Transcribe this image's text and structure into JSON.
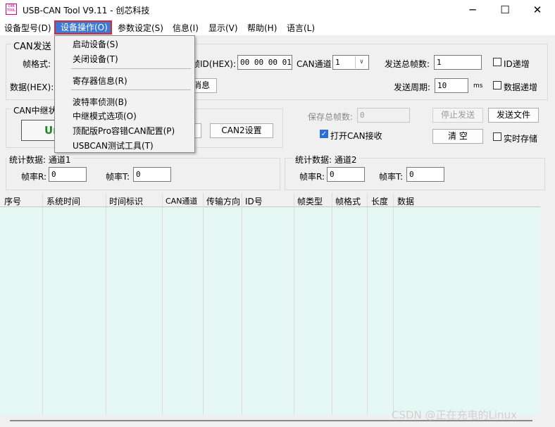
{
  "window": {
    "title": "USB-CAN Tool V9.11 - 创芯科技",
    "icon_text": [
      "CAN",
      "TOOL"
    ],
    "controls": {
      "minimize": "─",
      "maximize": "☐",
      "close": "✕"
    }
  },
  "menubar": {
    "items": [
      "设备型号(D)",
      "设备操作(O)",
      "参数设定(S)",
      "信息(I)",
      "显示(V)",
      "帮助(H)",
      "语言(L)"
    ],
    "active_index": 1
  },
  "dropdown": {
    "groups": [
      [
        "启动设备(S)",
        "关闭设备(T)"
      ],
      [
        "寄存器信息(R)"
      ],
      [
        "波特率侦测(B)",
        "中继模式选项(O)",
        "顶配版Pro容错CAN配置(P)",
        "USBCAN测试工具(T)"
      ]
    ]
  },
  "can_send": {
    "group_title": "CAN发送",
    "frame_format_label": "帧格式:",
    "data_label": "数据(HEX):",
    "frame_id_label": "帧ID(HEX):",
    "frame_id_value": "00 00 00 01",
    "channel_label": "CAN通道:",
    "channel_value": "1",
    "total_frames_label": "发送总帧数:",
    "total_frames_value": "1",
    "id_increment_label": "ID递增",
    "period_label": "发送周期:",
    "period_value": "10",
    "period_unit": "ms",
    "data_increment_label": "数据递增",
    "send_message_fragment": "消息"
  },
  "can_relay": {
    "group_title": "CAN中继状态",
    "status_fragment": "Ur",
    "can2_settings_label": "CAN2设置",
    "saved_frames_label": "保存总帧数:",
    "saved_frames_value": "0",
    "open_receive_label": "打开CAN接收",
    "stop_send_label": "停止发送",
    "send_file_label": "发送文件",
    "clear_label": "清 空",
    "realtime_save_label": "实时存储"
  },
  "stats": [
    {
      "title": "统计数据: 通道1",
      "rate_r_label": "帧率R:",
      "rate_r_value": "0",
      "rate_t_label": "帧率T:",
      "rate_t_value": "0"
    },
    {
      "title": "统计数据: 通道2",
      "rate_r_label": "帧率R:",
      "rate_r_value": "0",
      "rate_t_label": "帧率T:",
      "rate_t_value": "0"
    }
  ],
  "table": {
    "columns": [
      "序号",
      "系统时间",
      "时间标识",
      "CAN通道",
      "传输方向",
      "ID号",
      "帧类型",
      "帧格式",
      "长度",
      "数据"
    ]
  },
  "watermark": "CSDN @正在充电的Linux",
  "colors": {
    "accent": "#3b78d8",
    "highlight_border": "#e0282c",
    "grid_bg": "#e6f8f4",
    "status_green": "#1d8a2a"
  }
}
